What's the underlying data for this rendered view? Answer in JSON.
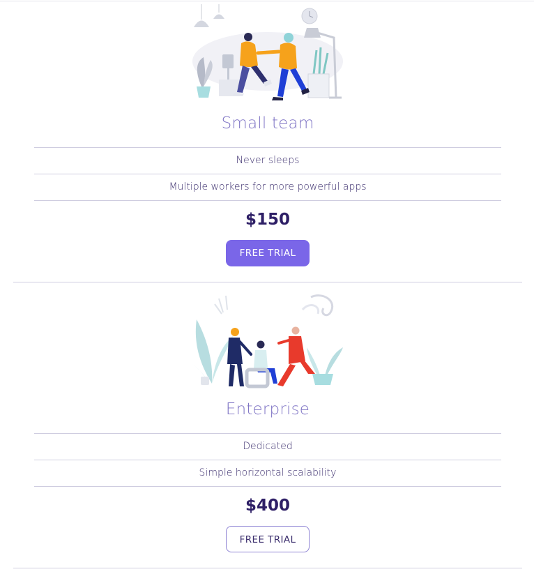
{
  "plans": [
    {
      "illustration": "two-people-dancing-illustration",
      "name": "Small team",
      "features": [
        "Never sleeps",
        "Multiple workers for more powerful apps"
      ],
      "price": "$150",
      "cta_label": "FREE TRIAL",
      "cta_style": "filled"
    },
    {
      "illustration": "three-people-meeting-illustration",
      "name": "Enterprise",
      "features": [
        "Dedicated",
        "Simple horizontal scalability"
      ],
      "price": "$400",
      "cta_label": "FREE TRIAL",
      "cta_style": "outlined"
    }
  ],
  "colors": {
    "accent": "#7a66e8",
    "heading": "#7d72c4",
    "price": "#2e1f66",
    "text": "#3c2f6e",
    "divider": "#cfcde0"
  }
}
